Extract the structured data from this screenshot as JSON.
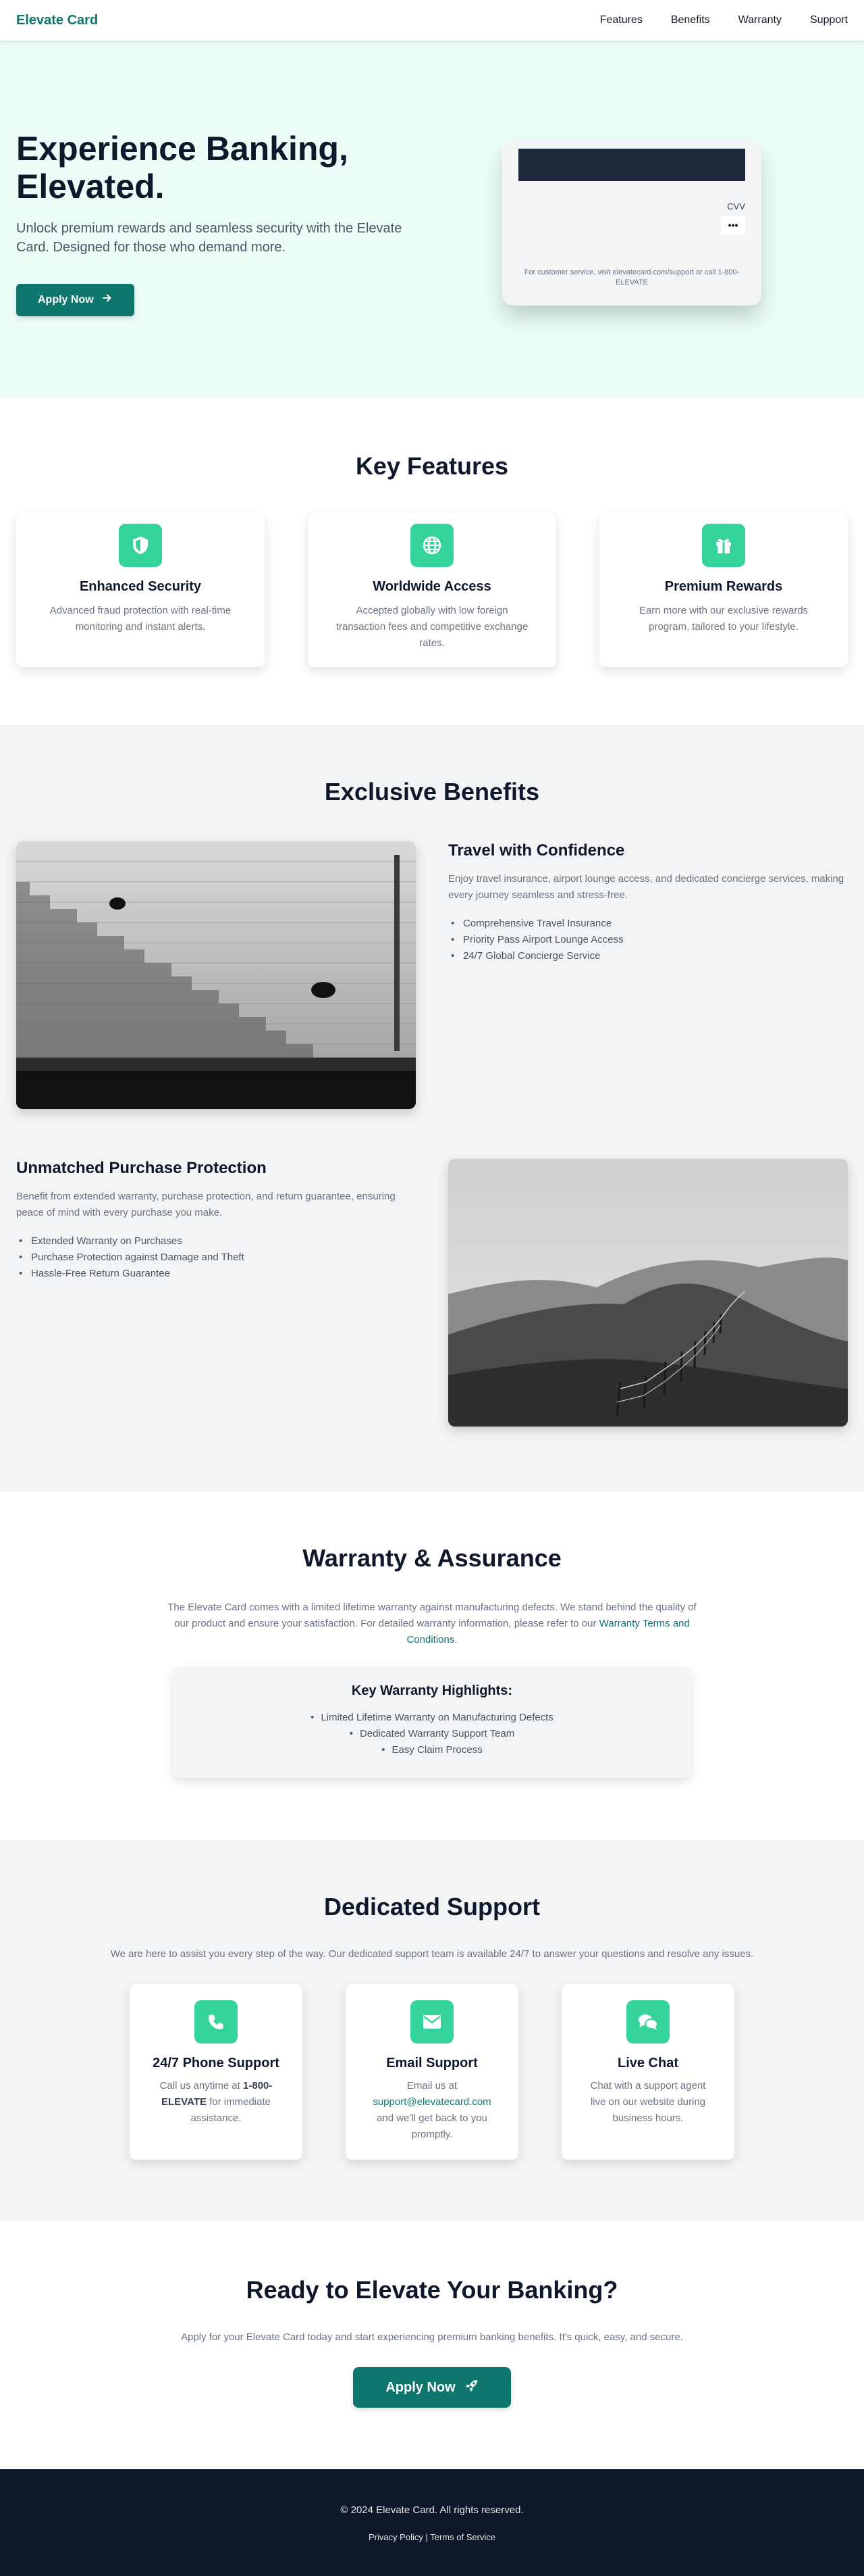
{
  "nav": {
    "brand": "Elevate Card",
    "links": [
      "Features",
      "Benefits",
      "Warranty",
      "Support"
    ]
  },
  "hero": {
    "title": "Experience Banking, Elevated.",
    "subtitle": "Unlock premium rewards and seamless security with the Elevate Card. Designed for those who demand more.",
    "cta_label": "Apply Now",
    "card": {
      "cvv_label": "CVV",
      "cvv_value": "•••",
      "note": "For customer service, visit elevatecard.com/support or call 1-800-ELEVATE"
    }
  },
  "features": {
    "title": "Key Features",
    "items": [
      {
        "icon": "shield-icon",
        "title": "Enhanced Security",
        "text": "Advanced fraud protection with real-time monitoring and instant alerts."
      },
      {
        "icon": "globe-icon",
        "title": "Worldwide Access",
        "text": "Accepted globally with low foreign transaction fees and competitive exchange rates."
      },
      {
        "icon": "gift-icon",
        "title": "Premium Rewards",
        "text": "Earn more with our exclusive rewards program, tailored to your lifestyle."
      }
    ]
  },
  "benefits": {
    "title": "Exclusive Benefits",
    "items": [
      {
        "title": "Travel with Confidence",
        "text": "Enjoy travel insurance, airport lounge access, and dedicated concierge services, making every journey seamless and stress-free.",
        "bullets": [
          "Comprehensive Travel Insurance",
          "Priority Pass Airport Lounge Access",
          "24/7 Global Concierge Service"
        ]
      },
      {
        "title": "Unmatched Purchase Protection",
        "text": "Benefit from extended warranty, purchase protection, and return guarantee, ensuring peace of mind with every purchase you make.",
        "bullets": [
          "Extended Warranty on Purchases",
          "Purchase Protection against Damage and Theft",
          "Hassle-Free Return Guarantee"
        ]
      }
    ]
  },
  "warranty": {
    "title": "Warranty & Assurance",
    "intro": "The Elevate Card comes with a limited lifetime warranty against manufacturing defects. We stand behind the quality of our product and ensure your satisfaction. For detailed warranty information, please refer to our",
    "link": "Warranty Terms and Conditions",
    "link_suffix": ".",
    "highlights_title": "Key Warranty Highlights:",
    "highlights": [
      "Limited Lifetime Warranty on Manufacturing Defects",
      "Dedicated Warranty Support Team",
      "Easy Claim Process"
    ]
  },
  "support": {
    "title": "Dedicated Support",
    "intro": "We are here to assist you every step of the way. Our dedicated support team is available 24/7 to answer your questions and resolve any issues.",
    "phone": {
      "title": "24/7 Phone Support",
      "pre": "Call us anytime at ",
      "number": "1-800-ELEVATE",
      "post": " for immediate assistance."
    },
    "email": {
      "title": "Email Support",
      "pre": "Email us at ",
      "address": "support@elevatecard.com",
      "post": " and we'll get back to you promptly."
    },
    "chat": {
      "title": "Live Chat",
      "text": "Chat with a support agent live on our website during business hours."
    }
  },
  "cta": {
    "title": "Ready to Elevate Your Banking?",
    "intro": "Apply for your Elevate Card today and start experiencing premium banking benefits. It's quick, easy, and secure.",
    "button": "Apply Now"
  },
  "footer": {
    "copyright": "© 2024 Elevate Card. All rights reserved.",
    "privacy": "Privacy Policy",
    "separator": " | ",
    "terms": "Terms of Service"
  },
  "colors": {
    "brand": "#0f766e",
    "accent": "#34d399",
    "hero_bg": "#ecfdf7",
    "footer_bg": "#0f172a"
  }
}
